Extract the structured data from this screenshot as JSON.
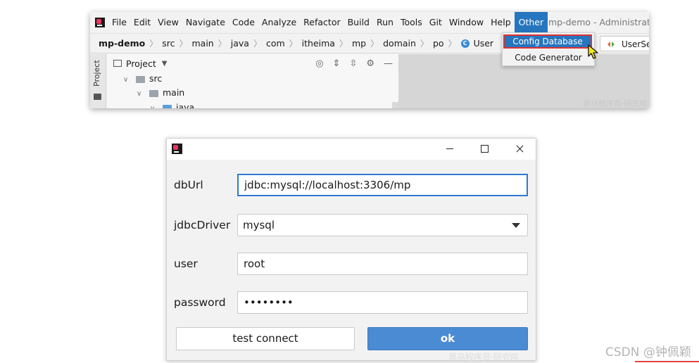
{
  "ide": {
    "menu": [
      "File",
      "Edit",
      "View",
      "Navigate",
      "Code",
      "Analyze",
      "Refactor",
      "Build",
      "Run",
      "Tools",
      "Git",
      "Window",
      "Help",
      "Other"
    ],
    "window_title": "mp-demo - Administrator",
    "breadcrumb": [
      "mp-demo",
      "src",
      "main",
      "java",
      "com",
      "itheima",
      "mp",
      "domain",
      "po",
      "User"
    ],
    "side_strip_label": "Project",
    "project_panel": {
      "title": "Project",
      "tree": [
        "src",
        "main",
        "java"
      ]
    },
    "editor_tab": "UserSer",
    "other_menu": {
      "items": [
        "Config Database",
        "Code Generator"
      ],
      "selected": "Config Database"
    },
    "watermark": "黑马程序员·研究院"
  },
  "dialog": {
    "fields": {
      "dburl": {
        "label": "dbUrl",
        "value": "jdbc:mysql://localhost:3306/mp"
      },
      "driver": {
        "label": "jdbcDriver",
        "value": "mysql"
      },
      "user": {
        "label": "user",
        "value": "root"
      },
      "password": {
        "label": "password",
        "value": "12345678"
      }
    },
    "buttons": {
      "test": "test connect",
      "ok": "ok"
    },
    "watermark": "黑马程序员·研究院"
  },
  "page_watermark": "CSDN @钟佩颖",
  "colors": {
    "accent": "#2675bf",
    "ok_button": "#4a8bd4",
    "highlight_border": "#e03030"
  }
}
